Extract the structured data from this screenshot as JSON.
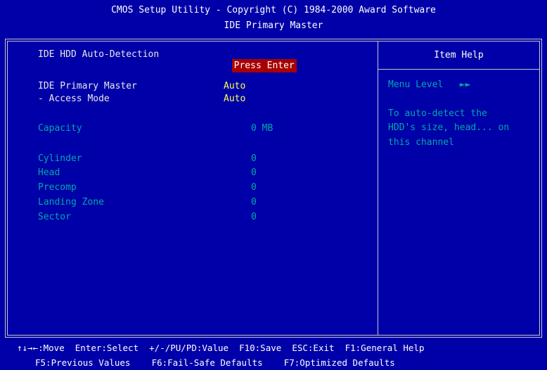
{
  "header": {
    "title": "CMOS Setup Utility - Copyright (C) 1984-2000 Award Software",
    "subtitle": "IDE Primary Master"
  },
  "main": {
    "autodetect": {
      "label": "IDE HDD Auto-Detection",
      "value": "Press Enter"
    },
    "primary_master": {
      "label": "IDE Primary Master",
      "value": "Auto"
    },
    "access_mode": {
      "label": "- Access Mode",
      "value": "Auto"
    },
    "capacity": {
      "label": "Capacity",
      "value": "0 MB"
    },
    "cylinder": {
      "label": "Cylinder",
      "value": "0"
    },
    "head": {
      "label": "Head",
      "value": "0"
    },
    "precomp": {
      "label": "Precomp",
      "value": "0"
    },
    "landing_zone": {
      "label": "Landing Zone",
      "value": "0"
    },
    "sector": {
      "label": "Sector",
      "value": "0"
    }
  },
  "help": {
    "title": "Item Help",
    "menu_level_label": "Menu Level",
    "menu_level_icon": "double-right-arrow-icon",
    "menu_level_glyph": "►►",
    "text_line1": "To auto-detect the",
    "text_line2": "HDD's size, head... on",
    "text_line3": "this channel"
  },
  "footer": {
    "line1": "↑↓→←:Move  Enter:Select  +/-/PU/PD:Value  F10:Save  ESC:Exit  F1:General Help",
    "line2": "F5:Previous Values    F6:Fail-Safe Defaults    F7:Optimized Defaults"
  },
  "colors": {
    "background": "#0000a8",
    "highlight": "#a80000",
    "value": "#ffff54",
    "disabled": "#00a8a8",
    "text": "#e8e8e8"
  }
}
